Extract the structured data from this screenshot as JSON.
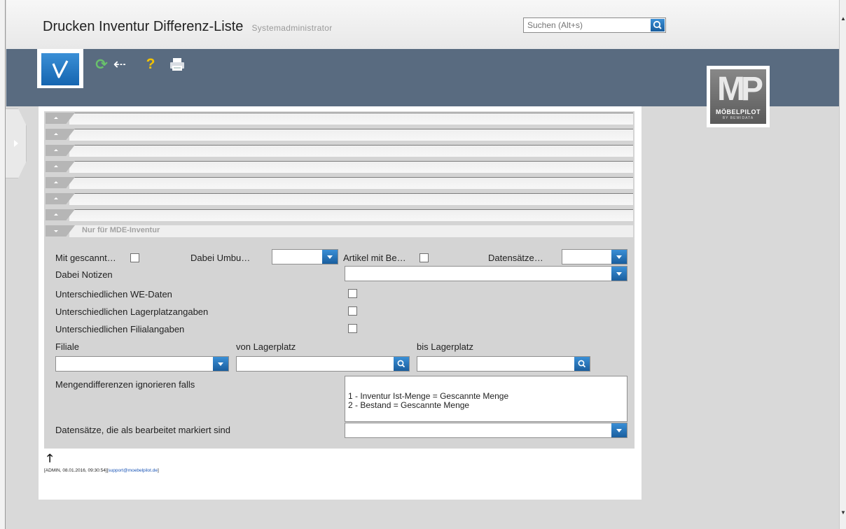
{
  "header": {
    "title": "Drucken Inventur Differenz-Liste",
    "user_role": "Systemadministrator",
    "search_placeholder": "Suchen (Alt+s)"
  },
  "toolbar": {
    "icons": [
      "confirm-check-icon",
      "refresh-icon",
      "back-arrow-icon",
      "help-icon",
      "print-icon"
    ],
    "refresh_glyph": "⟳",
    "back_glyph": "⇠",
    "help_glyph": "?"
  },
  "logo": {
    "mark": "MP",
    "brand": "MÖBELPILOT",
    "sub": "BY BEWIDATA"
  },
  "colors": {
    "accent_blue": "#1a6fc0",
    "toolbar_bg": "#596b80",
    "form_bg": "#d4d4d4",
    "link": "#1a55b6"
  },
  "sections": {
    "collapsed_count": 7,
    "open_label": "Nur für MDE-Inventur"
  },
  "form": {
    "row1": {
      "mit_gescannt": "Mit gescannt…",
      "dabei_umbu": "Dabei Umbu…",
      "artikel_mit_be": "Artikel mit Be…",
      "datensaetze": "Datensätze…"
    },
    "dabei_notizen": "Dabei Notizen",
    "we_daten": "Unterschiedlichen WE-Daten",
    "lagerplatz": "Unterschiedlichen Lagerplatzangaben",
    "filial": "Unterschiedlichen Filialangaben",
    "filiale": "Filiale",
    "von_lagerplatz": "von Lagerplatz",
    "bis_lagerplatz": "bis Lagerplatz",
    "mengen_label": "Mengendifferenzen ignorieren falls",
    "mengen_options": [
      "1 - Inventur Ist-Menge = Gescannte Menge",
      "2 - Bestand = Gescannte Menge"
    ],
    "bearbeitet": "Datensätze, die als bearbeitet markiert sind"
  },
  "footer": {
    "up_arrow": "🡑",
    "status_prefix": "[ADMIN, 08.01.2016, 09:30:54][",
    "support_email": "support@moebelpilot.de",
    "status_suffix": "]"
  }
}
